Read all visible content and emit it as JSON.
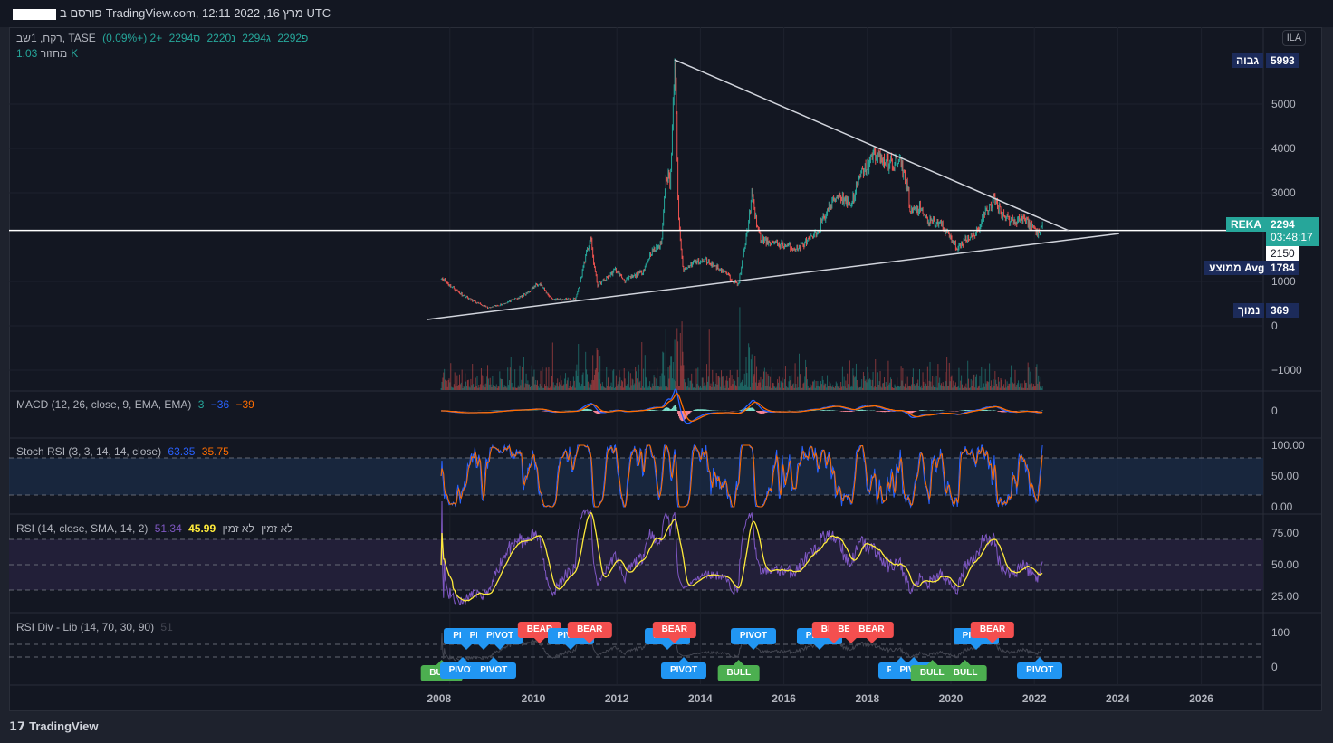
{
  "header": {
    "title": "פורסם ב-TradingView.com, 12:11 2022 ,16 מרץ UTC"
  },
  "legend": {
    "symbol": "רקח, 1שב, TASE",
    "open": "פ2292",
    "high": "ג2294",
    "low": "נ2220",
    "close": "ס2294",
    "change": "+2 (+0.09%)",
    "volume_label": "מחזור",
    "volume_value": "1.03K"
  },
  "indicators": {
    "macd": {
      "label": "MACD (12, 26, close, 9, EMA, EMA)",
      "hist": "3",
      "macd": "−36",
      "signal": "−39"
    },
    "stoch": {
      "label": "Stoch RSI (3, 3, 14, 14, close)",
      "k": "63.35",
      "d": "35.75"
    },
    "rsi": {
      "label": "RSI (14, close, SMA, 14, 2)",
      "rsi": "51.34",
      "ma": "45.99",
      "na": "לא זמין",
      "na2": "לא זמין"
    },
    "rsidiv": {
      "label": "RSI Div - Lib (14, 70, 30, 90)",
      "value": "51"
    }
  },
  "currency": "ILA",
  "price_tags": {
    "high_label": "גבוה",
    "high": "5993",
    "symbol": "REKA",
    "last": "2294",
    "countdown": "03:48:17",
    "line": "2150",
    "avg_label": "ממוצע Avg",
    "avg": "1784",
    "low_label": "נמוך",
    "low": "369"
  },
  "colors": {
    "up": "#26a69a",
    "down": "#ef5350",
    "macd": "#2962ff",
    "signal": "#ff6d00",
    "rsi": "#7e57c2",
    "rsi_ma": "#ffeb3b"
  },
  "footer": {
    "brand": "TradingView"
  },
  "chart_data": {
    "type": "candlestick",
    "title": "REKA (TASE) weekly",
    "price_axis_ticks": [
      "5000",
      "4000",
      "3000",
      "1000",
      "0",
      "−1000"
    ],
    "price_axis_values": [
      5000,
      4000,
      3000,
      1000,
      0,
      -1000
    ],
    "time_axis_ticks": [
      "2008",
      "2010",
      "2012",
      "2014",
      "2016",
      "2018",
      "2020",
      "2022",
      "2024",
      "2026"
    ],
    "time_axis_years": [
      2008,
      2010,
      2012,
      2014,
      2016,
      2018,
      2020,
      2022,
      2024,
      2026
    ],
    "price_anchors": [
      [
        2007.79,
        1100
      ],
      [
        2008.94,
        400
      ],
      [
        2009.8,
        700
      ],
      [
        2010.13,
        980
      ],
      [
        2010.46,
        600
      ],
      [
        2011.0,
        600
      ],
      [
        2011.21,
        1430
      ],
      [
        2011.37,
        2000
      ],
      [
        2011.54,
        920
      ],
      [
        2011.97,
        1270
      ],
      [
        2012.19,
        1020
      ],
      [
        2012.62,
        1220
      ],
      [
        2012.8,
        1630
      ],
      [
        2013.06,
        1840
      ],
      [
        2013.17,
        3470
      ],
      [
        2013.28,
        3270
      ],
      [
        2013.38,
        5993
      ],
      [
        2013.42,
        4900
      ],
      [
        2013.49,
        2240
      ],
      [
        2013.6,
        1220
      ],
      [
        2013.82,
        1430
      ],
      [
        2014.14,
        1470
      ],
      [
        2014.58,
        1220
      ],
      [
        2014.9,
        920
      ],
      [
        2015.05,
        1730
      ],
      [
        2015.23,
        2960
      ],
      [
        2015.44,
        1940
      ],
      [
        2015.88,
        1840
      ],
      [
        2016.31,
        1730
      ],
      [
        2016.75,
        2040
      ],
      [
        2017.07,
        2650
      ],
      [
        2017.29,
        2960
      ],
      [
        2017.61,
        2760
      ],
      [
        2017.83,
        3370
      ],
      [
        2018.16,
        3880
      ],
      [
        2018.48,
        3670
      ],
      [
        2018.81,
        3670
      ],
      [
        2018.98,
        3060
      ],
      [
        2019.02,
        2550
      ],
      [
        2019.24,
        2650
      ],
      [
        2019.46,
        2350
      ],
      [
        2019.78,
        2290
      ],
      [
        2020.17,
        1730
      ],
      [
        2020.33,
        1940
      ],
      [
        2020.65,
        2140
      ],
      [
        2020.76,
        2450
      ],
      [
        2021.04,
        2860
      ],
      [
        2021.3,
        2450
      ],
      [
        2021.52,
        2350
      ],
      [
        2021.74,
        2450
      ],
      [
        2021.95,
        2240
      ],
      [
        2022.13,
        2080
      ],
      [
        2022.21,
        2294
      ]
    ],
    "horizontal_line": 2150,
    "trendlines": [
      {
        "from": [
          2013.38,
          6000
        ],
        "to": [
          2022.84,
          2140
        ]
      },
      {
        "from": [
          2007.46,
          143
        ],
        "to": [
          2024.03,
          2080
        ]
      }
    ],
    "rsi_levels": [
      70,
      50,
      30
    ],
    "stoch_levels": [
      80,
      20
    ],
    "stoch_ticks": [
      "100.00",
      "50.00",
      "0.00"
    ],
    "rsi_ticks": [
      "75.00",
      "50.00",
      "25.00"
    ],
    "rsidiv_ticks": [
      "100",
      "0"
    ],
    "macd_ticks": [
      "0"
    ],
    "signals": [
      {
        "text": "PIVOT",
        "year": 2008.4,
        "side": "above"
      },
      {
        "text": "PIVOT",
        "year": 2008.8,
        "side": "above"
      },
      {
        "text": "PIVOT",
        "year": 2009.2,
        "side": "above"
      },
      {
        "text": "BEAR",
        "year": 2010.15,
        "side": "above"
      },
      {
        "text": "PIVOT",
        "year": 2010.9,
        "side": "above"
      },
      {
        "text": "BEAR",
        "year": 2011.35,
        "side": "above"
      },
      {
        "text": "PIVOT",
        "year": 2013.2,
        "side": "above"
      },
      {
        "text": "BEAR",
        "year": 2013.38,
        "side": "above"
      },
      {
        "text": "PIVOT",
        "year": 2015.27,
        "side": "above"
      },
      {
        "text": "PIVOT",
        "year": 2016.85,
        "side": "above"
      },
      {
        "text": "BEAR",
        "year": 2017.2,
        "side": "above"
      },
      {
        "text": "BEAR",
        "year": 2017.6,
        "side": "above"
      },
      {
        "text": "BEAR",
        "year": 2018.1,
        "side": "above"
      },
      {
        "text": "PIVOT",
        "year": 2020.6,
        "side": "above"
      },
      {
        "text": "BEAR",
        "year": 2021.0,
        "side": "above"
      },
      {
        "text": "BULL",
        "year": 2007.8,
        "side": "below"
      },
      {
        "text": "PIVOT",
        "year": 2008.3,
        "side": "below"
      },
      {
        "text": "PIVOT",
        "year": 2009.05,
        "side": "below"
      },
      {
        "text": "PIVOT",
        "year": 2013.6,
        "side": "below"
      },
      {
        "text": "BULL",
        "year": 2014.92,
        "side": "below"
      },
      {
        "text": "PIVOT",
        "year": 2018.8,
        "side": "below"
      },
      {
        "text": "PIVOT",
        "year": 2019.1,
        "side": "below"
      },
      {
        "text": "BULL",
        "year": 2019.55,
        "side": "below"
      },
      {
        "text": "BULL",
        "year": 2020.35,
        "side": "below"
      },
      {
        "text": "PIVOT",
        "year": 2022.13,
        "side": "below"
      }
    ]
  }
}
